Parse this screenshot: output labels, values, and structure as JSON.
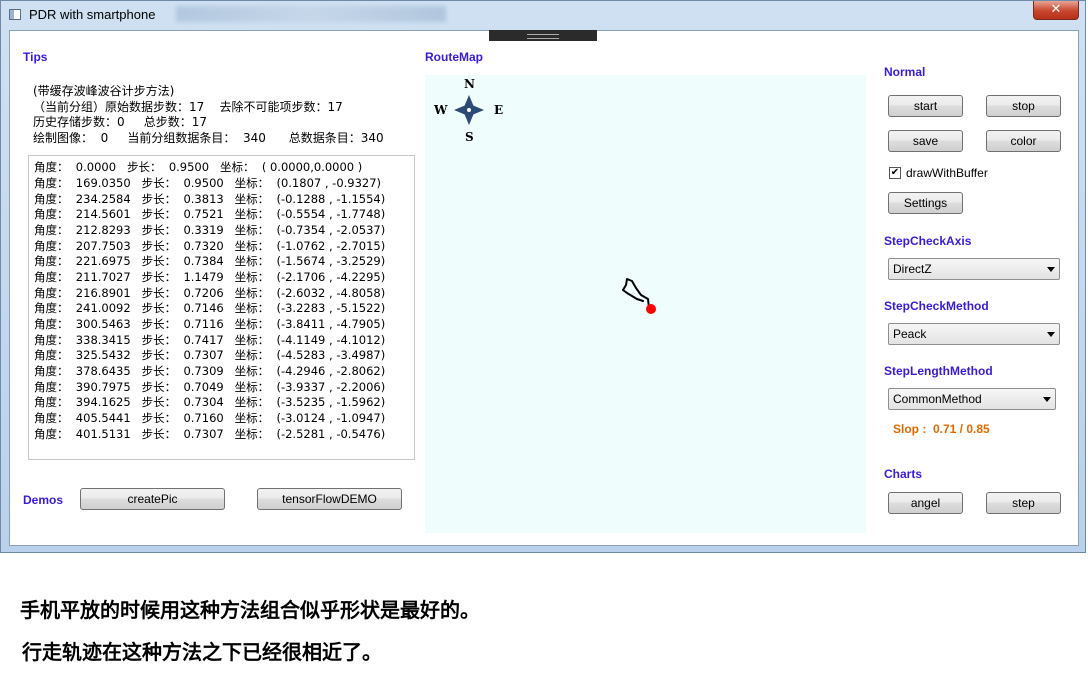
{
  "window": {
    "title": "PDR  with smartphone",
    "close_glyph": "✕"
  },
  "tips": {
    "heading": "Tips",
    "lines": [
      "(带缓存波峰波谷计步方法)",
      "（当前分组）原始数据步数：17    去除不可能项步数：17",
      "历史存储步数：0     总步数：17",
      "绘制图像：  0     当前分组数据条目：  340      总数据条目：340"
    ]
  },
  "log": [
    "角度：  0.0000   步长：  0.9500   坐标：  ( 0.0000,0.0000 )",
    "角度：  169.0350   步长：  0.9500   坐标：  (0.1807 , -0.9327)",
    "角度：  234.2584   步长：  0.3813   坐标：  (-0.1288 , -1.1554)",
    "角度：  214.5601   步长：  0.7521   坐标：  (-0.5554 , -1.7748)",
    "角度：  212.8293   步长：  0.3319   坐标：  (-0.7354 , -2.0537)",
    "角度：  207.7503   步长：  0.7320   坐标：  (-1.0762 , -2.7015)",
    "角度：  221.6975   步长：  0.7384   坐标：  (-1.5674 , -3.2529)",
    "角度：  211.7027   步长：  1.1479   坐标：  (-2.1706 , -4.2295)",
    "角度：  216.8901   步长：  0.7206   坐标：  (-2.6032 , -4.8058)",
    "角度：  241.0092   步长：  0.7146   坐标：  (-3.2283 , -5.1522)",
    "角度：  300.5463   步长：  0.7116   坐标：  (-3.8411 , -4.7905)",
    "角度：  338.3415   步长：  0.7417   坐标：  (-4.1149 , -4.1012)",
    "角度：  325.5432   步长：  0.7307   坐标：  (-4.5283 , -3.4987)",
    "角度：  378.6435   步长：  0.7309   坐标：  (-4.2946 , -2.8062)",
    "角度：  390.7975   步长：  0.7049   坐标：  (-3.9337 , -2.2006)",
    "角度：  394.1625   步长：  0.7304   坐标：  (-3.5235 , -1.5962)",
    "角度：  405.5441   步长：  0.7160   坐标：  (-3.0124 , -1.0947)",
    "角度：  401.5131   步长：  0.7307   坐标：  (-2.5281 , -0.5476)"
  ],
  "demos": {
    "heading": "Demos",
    "createpic": "createPic",
    "tensorflow": "tensorFlowDEMO"
  },
  "routemap": {
    "heading": "RouteMap",
    "compass": {
      "n": "N",
      "s": "S",
      "e": "E",
      "w": "W"
    },
    "track_color": "#000000",
    "end_marker_color": "#ff0000",
    "map_background": "#f0fdfd"
  },
  "normal": {
    "heading": "Normal",
    "start": "start",
    "stop": "stop",
    "save": "save",
    "color": "color",
    "draw_with_buffer": "drawWithBuffer",
    "draw_with_buffer_checked": "✔",
    "settings": "Settings"
  },
  "step_check_axis": {
    "heading": "StepCheckAxis",
    "selected": "DirectZ"
  },
  "step_check_method": {
    "heading": "StepCheckMethod",
    "selected": "Peack"
  },
  "step_length_method": {
    "heading": "StepLengthMethod",
    "selected": "CommonMethod"
  },
  "slop": {
    "text": "Slop :  0.71 / 0.85",
    "color": "#e06a00"
  },
  "charts": {
    "heading": "Charts",
    "angel": "angel",
    "step": "step"
  },
  "captions": [
    "手机平放的时候用这种方法组合似乎形状是最好的。",
    "行走轨迹在这种方法之下已经很相近了。"
  ]
}
